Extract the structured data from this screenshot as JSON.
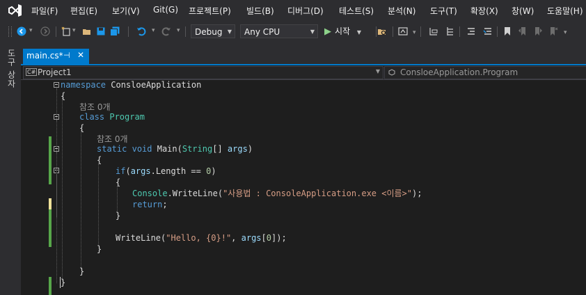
{
  "menu": [
    "파일(F)",
    "편집(E)",
    "보기(V)",
    "Git(G)",
    "프로젝트(P)",
    "빌드(B)",
    "디버그(D)",
    "테스트(S)",
    "분석(N)",
    "도구(T)",
    "확장(X)",
    "창(W)",
    "도움말(H)"
  ],
  "toolbar": {
    "config": "Debug",
    "platform": "Any CPU",
    "start_label": "시작"
  },
  "left_strip": {
    "label": "도구 상자"
  },
  "tab": {
    "title": "main.cs*",
    "pin_glyph": "⊣",
    "close_glyph": "✕"
  },
  "nav": {
    "project_icon": "C#",
    "project": "Project1",
    "class": "ConsloeApplication.Program"
  },
  "code": {
    "l1_kw": "namespace",
    "l1_name": " ConsloeApplication",
    "l2": "{",
    "l3_lens": "참조 0개",
    "l4_kw": "class",
    "l4_name": "Program",
    "l5": "{",
    "l6_lens": "참조 0개",
    "l7_kw1": "static",
    "l7_kw2": "void",
    "l7_name": "Main(",
    "l7_type": "String",
    "l7_rest": "[] ",
    "l7_param": "args",
    "l7_end": ")",
    "l8": "{",
    "l9_kw": "if",
    "l9_open": "(",
    "l9_var": "args",
    "l9_mid": ".Length == ",
    "l9_num": "0",
    "l9_end": ")",
    "l10": "{",
    "l11_type": "Console",
    "l11_mid": ".WriteLine(",
    "l11_str": "\"사용법 : ConsoleApplication.exe <이름>\"",
    "l11_end": ");",
    "l12_kw": "return",
    "l12_end": ";",
    "l13": "}",
    "l14_fn": "WriteLine(",
    "l14_str": "\"Hello, {0}!\"",
    "l14_mid": ", ",
    "l14_var": "args",
    "l14_idx": "[",
    "l14_num": "0",
    "l14_end": "]);",
    "l15": "}",
    "l16": "}",
    "l17": "}"
  },
  "colors": {
    "accent": "#007acc",
    "changed_saved": "#57a64a",
    "changed_unsaved": "#efe29a",
    "keyword": "#569cd6",
    "type": "#4ec9b0",
    "string": "#d69d85"
  }
}
